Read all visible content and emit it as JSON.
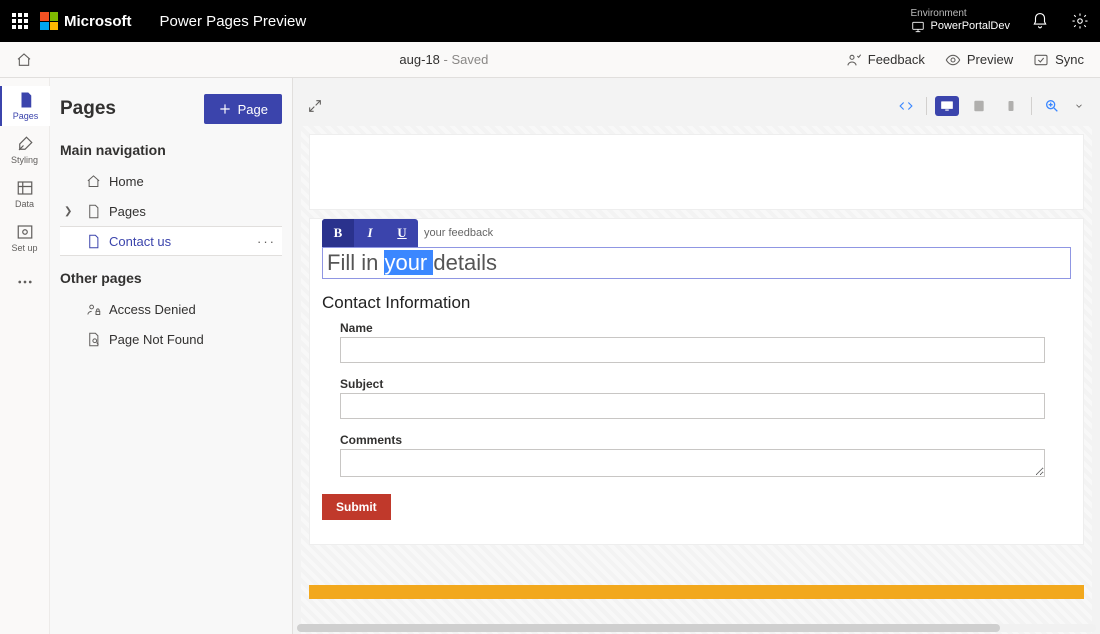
{
  "topbar": {
    "brand": "Microsoft",
    "app": "Power Pages Preview",
    "env_label": "Environment",
    "env_value": "PowerPortalDev"
  },
  "cmdbar": {
    "doc_name": "aug-18",
    "saved_suffix": " - Saved",
    "feedback": "Feedback",
    "preview": "Preview",
    "sync": "Sync"
  },
  "rail": {
    "pages": "Pages",
    "styling": "Styling",
    "data": "Data",
    "setup": "Set up"
  },
  "sidepanel": {
    "title": "Pages",
    "add_page": "Page",
    "main_nav": "Main navigation",
    "other_pages": "Other pages",
    "items": {
      "home": "Home",
      "pages": "Pages",
      "contact": "Contact us",
      "access_denied": "Access Denied",
      "not_found": "Page Not Found"
    }
  },
  "editor": {
    "toolbar_label": "your feedback",
    "heading_pre": "Fill in ",
    "heading_sel": "your ",
    "heading_post": "details",
    "section_title": "Contact Information",
    "fields": {
      "name": "Name",
      "subject": "Subject",
      "comments": "Comments"
    },
    "submit": "Submit"
  }
}
